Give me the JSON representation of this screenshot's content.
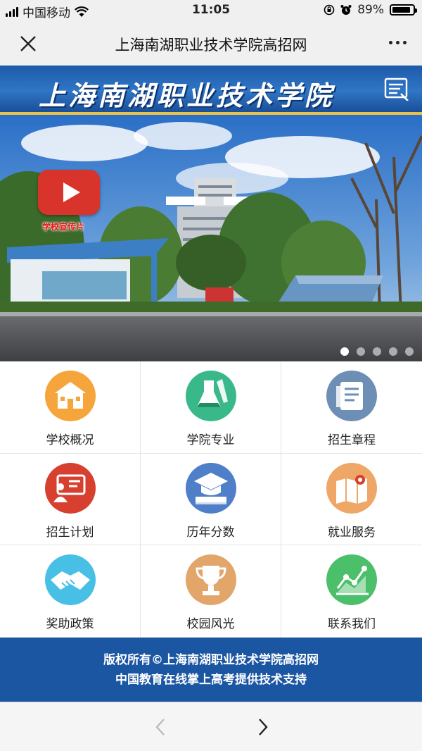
{
  "status_bar": {
    "carrier": "中国移动",
    "time": "11:05",
    "battery": "89%",
    "battery_level": 0.89,
    "icons": [
      "signal-icon",
      "wifi-icon",
      "rotation-lock-icon",
      "alarm-icon",
      "battery-icon"
    ]
  },
  "nav": {
    "title": "上海南湖职业技术学院高招网",
    "close_icon": "close-icon",
    "more_icon": "more-icon"
  },
  "header": {
    "school_name": "上海南湖职业技术学院",
    "menu_icon": "menu-icon"
  },
  "carousel": {
    "video_label": "学校宣传片",
    "slide_count": 5,
    "active_slide": 1
  },
  "menu": [
    {
      "label": "学校概况",
      "icon": "school-icon",
      "color": "#f5a53c"
    },
    {
      "label": "学院专业",
      "icon": "flask-icon",
      "color": "#39b98a"
    },
    {
      "label": "招生章程",
      "icon": "document-icon",
      "color": "#6d8fb5"
    },
    {
      "label": "招生计划",
      "icon": "presentation-icon",
      "color": "#d7402f"
    },
    {
      "label": "历年分数",
      "icon": "graduation-cap-icon",
      "color": "#4f7fc9"
    },
    {
      "label": "就业服务",
      "icon": "map-icon",
      "color": "#efa768"
    },
    {
      "label": "奖助政策",
      "icon": "handshake-icon",
      "color": "#48c0e6"
    },
    {
      "label": "校园风光",
      "icon": "trophy-icon",
      "color": "#e2a56a"
    },
    {
      "label": "联系我们",
      "icon": "chart-icon",
      "color": "#4cbf6a"
    }
  ],
  "footer": {
    "line1": "版权所有©上海南湖职业技术学院高招网",
    "line2": "中国教育在线掌上高考提供技术支持"
  },
  "bottom_bar": {
    "back_icon": "back-arrow-icon",
    "forward_icon": "forward-arrow-icon"
  }
}
